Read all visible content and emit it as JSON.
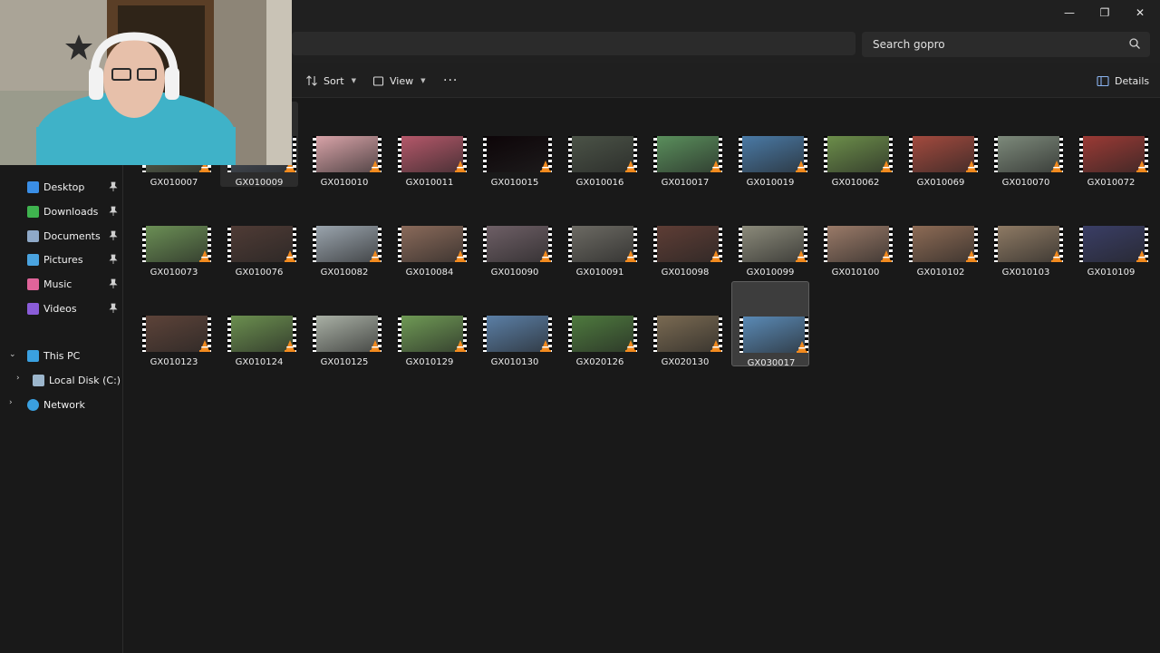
{
  "window": {
    "minimize": "—",
    "maximize": "❐",
    "close": "✕"
  },
  "search": {
    "placeholder": "Search gopro"
  },
  "toolbar": {
    "sort": "Sort",
    "view": "View",
    "more": "···",
    "details": "Details"
  },
  "sidebar": {
    "pinned": [
      {
        "label": "Desktop",
        "icon": "desktop-icon",
        "color": "#3a8ee6"
      },
      {
        "label": "Downloads",
        "icon": "downloads-icon",
        "color": "#3fb34f"
      },
      {
        "label": "Documents",
        "icon": "documents-icon",
        "color": "#8fa9c8"
      },
      {
        "label": "Pictures",
        "icon": "pictures-icon",
        "color": "#4aa3df"
      },
      {
        "label": "Music",
        "icon": "music-icon",
        "color": "#e0649a"
      },
      {
        "label": "Videos",
        "icon": "videos-icon",
        "color": "#8a5cd8"
      }
    ],
    "this_pc": "This PC",
    "local_disk": "Local Disk (C:)",
    "network": "Network"
  },
  "files": [
    {
      "name": "GX010007",
      "color": "#5f6b53"
    },
    {
      "name": "GX010009",
      "color": "#4d5662"
    },
    {
      "name": "GX010010",
      "color": "#d8a3a8"
    },
    {
      "name": "GX010011",
      "color": "#b5586a"
    },
    {
      "name": "GX010015",
      "color": "#0d0508"
    },
    {
      "name": "GX010016",
      "color": "#4b5347"
    },
    {
      "name": "GX010017",
      "color": "#5a8f5c"
    },
    {
      "name": "GX010019",
      "color": "#4a7aa6"
    },
    {
      "name": "GX010062",
      "color": "#6c8e4a"
    },
    {
      "name": "GX010069",
      "color": "#a34a3e"
    },
    {
      "name": "GX010070",
      "color": "#7d8a7b"
    },
    {
      "name": "GX010072",
      "color": "#9b3a35"
    },
    {
      "name": "GX010073",
      "color": "#6b8f55"
    },
    {
      "name": "GX010076",
      "color": "#4f3b35"
    },
    {
      "name": "GX010082",
      "color": "#9aa4ad"
    },
    {
      "name": "GX010084",
      "color": "#8a6a5a"
    },
    {
      "name": "GX010090",
      "color": "#6e5f66"
    },
    {
      "name": "GX010091",
      "color": "#6c6a63"
    },
    {
      "name": "GX010098",
      "color": "#5e3d35"
    },
    {
      "name": "GX010099",
      "color": "#8b8a7a"
    },
    {
      "name": "GX010100",
      "color": "#9a7a68"
    },
    {
      "name": "GX010102",
      "color": "#8d6b55"
    },
    {
      "name": "GX010103",
      "color": "#8e7a64"
    },
    {
      "name": "GX010109",
      "color": "#3a3e66"
    },
    {
      "name": "GX010123",
      "color": "#5d4339"
    },
    {
      "name": "GX010124",
      "color": "#6b8f4f"
    },
    {
      "name": "GX010125",
      "color": "#a9b0a5"
    },
    {
      "name": "GX010129",
      "color": "#6f9a55"
    },
    {
      "name": "GX010130",
      "color": "#5b7fa6"
    },
    {
      "name": "GX020126",
      "color": "#4e7a3e"
    },
    {
      "name": "GX020130",
      "color": "#7a6a52"
    },
    {
      "name": "GX030017",
      "color": "#5a8ab6"
    }
  ]
}
